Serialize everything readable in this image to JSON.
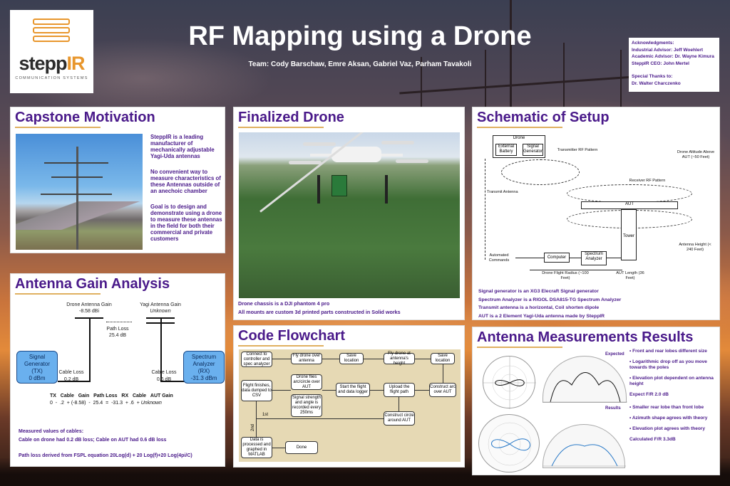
{
  "header": {
    "title": "RF Mapping using a Drone",
    "team": "Team: Cody Barschaw, Emre Aksan, Gabriel Vaz, Parham Tavakoli",
    "logo_text_a": "stepp",
    "logo_text_b": "IR",
    "logo_sub": "COMMUNICATION SYSTEMS"
  },
  "acknowledgments": {
    "heading": "Acknowledgments:",
    "lines": [
      "Industrial Advisor: Jeff Woehlert",
      "Academic Advisor: Dr. Wayne Kimura",
      "SteppIR CEO: John Mertel"
    ],
    "thanks_heading": "Special Thanks to:",
    "thanks": "Dr. Walter Charczenko"
  },
  "capstone": {
    "heading": "Capstone Motivation",
    "p1": "SteppIR is a leading manufacturer of mechanically adjustable Yagi-Uda antennas",
    "p2": "No convenient way to measure characteristics of these Antennas outside of an anechoic chamber",
    "p3": "Goal is to design and demonstrate using a drone to measure these antennas in the field for both their commercial and private customers"
  },
  "gain": {
    "heading": "Antenna Gain Analysis",
    "drone_gain_label": "Drone Antenna Gain",
    "drone_gain_value": "-8.58 dBi",
    "yagi_gain_label": "Yagi Antenna Gain",
    "yagi_gain_value": "Unknown",
    "path_loss_label": "Path Loss",
    "path_loss_value": "25.4 dB",
    "sg_box": [
      "Signal",
      "Generator",
      "(TX)",
      "0 dBm"
    ],
    "sa_box": [
      "Spectrum",
      "Analyzer",
      "(RX)",
      "-31.3 dBm"
    ],
    "cable_loss_left_label": "Cable Loss",
    "cable_loss_left_value": "0.2 dB",
    "cable_loss_right_label": "Cable Loss",
    "cable_loss_right_value": "0.6 dB",
    "eq_header": [
      "TX",
      "Cable",
      "Gain",
      "Path Loss",
      "RX",
      "Cable",
      "AUT Gain"
    ],
    "eq_values": [
      "0",
      "-",
      ".2",
      "+",
      "(-8.58)",
      "-",
      "25.4",
      "=",
      "-31.3",
      "+",
      ".6",
      "+",
      "Unknown"
    ],
    "note1": "Measured values of cables:",
    "note2": "Cable on drone had 0.2 dB loss; Cable on AUT had 0.6 dB loss",
    "note3": "Path loss derived from FSPL equation 20Log(d) + 20 Log(f)+20 Log(4pi/C)"
  },
  "drone": {
    "heading": "Finalized Drone",
    "cap1": "Drone chassis is a DJI phantom 4 pro",
    "cap2": "All mounts are custom 3d printed parts constructed in Solid works"
  },
  "schematic": {
    "heading": "Schematic of Setup",
    "drone": "Drone",
    "ext_battery": "External Battery",
    "sig_gen": "Signal Generator",
    "tx_pattern": "Transmitter RF Pattern",
    "altitude": "Drone Altitude Above AUT (~50 Feet)",
    "tx_antenna": "Transmit Antenna",
    "rx_pattern": "Receiver RF Pattern",
    "aut": "AUT",
    "tower": "Tower",
    "ant_height": "Antenna Height (< 240 Feet)",
    "auto_cmds": "Automated Commands",
    "computer": "Computer",
    "spec_an": "Spectrum Analyzer",
    "radius": "Drone Flight Radius (~100 Feet)",
    "aut_len": "AUT Length (36 Feet)",
    "cap1": "Signal generator is an XG3 Elecraft Signal generator",
    "cap2": "Spectrum Analyzer is a RIGOL DSA815-TG Spectrum Analyzer",
    "cap3": "Transmit antenna is a horizontal, Coil shorten dipole",
    "cap4": "AUT is a 2 Element Yagi-Uda antenna made by SteppIR"
  },
  "flow": {
    "heading": "Code Flowchart",
    "b1": "Connect to controller and spec analyzer",
    "b2": "Fly drone over antenna",
    "b3": "Save location",
    "b4": "Fly drone at antenna's height",
    "b5": "Save location",
    "b6": "Construct arc over AUT",
    "b7": "Upload the flight path",
    "b8": "Start the flight and data logger",
    "b9": "Drone flies arc/circle over AUT",
    "b10": "Signal strength and angle is recorded every 250ms",
    "b11": "Flight finishes, data dumped to CSV",
    "b12": "Construct circle around AUT",
    "b13": "Data is processed and graphed in MATLAB",
    "b14": "Done",
    "l1": "1st",
    "l2": "2nd"
  },
  "results": {
    "heading": "Antenna Measurements Results",
    "expected": "Expected",
    "results": "Results",
    "t1": "Front and rear lobes different size",
    "t2": "Logarithmic drop off as you move towards the poles",
    "t3": "Elevation plot dependent on antenna height",
    "t4": "Expect F/R 2.0 dB",
    "t5": "Smaller rear lobe than front lobe",
    "t6": "Azimuth shape agrees with theory",
    "t7": "Elevation plot agrees with theory",
    "t8": "Calculated F/R 3.3dB"
  },
  "colors": {
    "accent": "#4a1a8a",
    "brand": "#e8962c"
  }
}
